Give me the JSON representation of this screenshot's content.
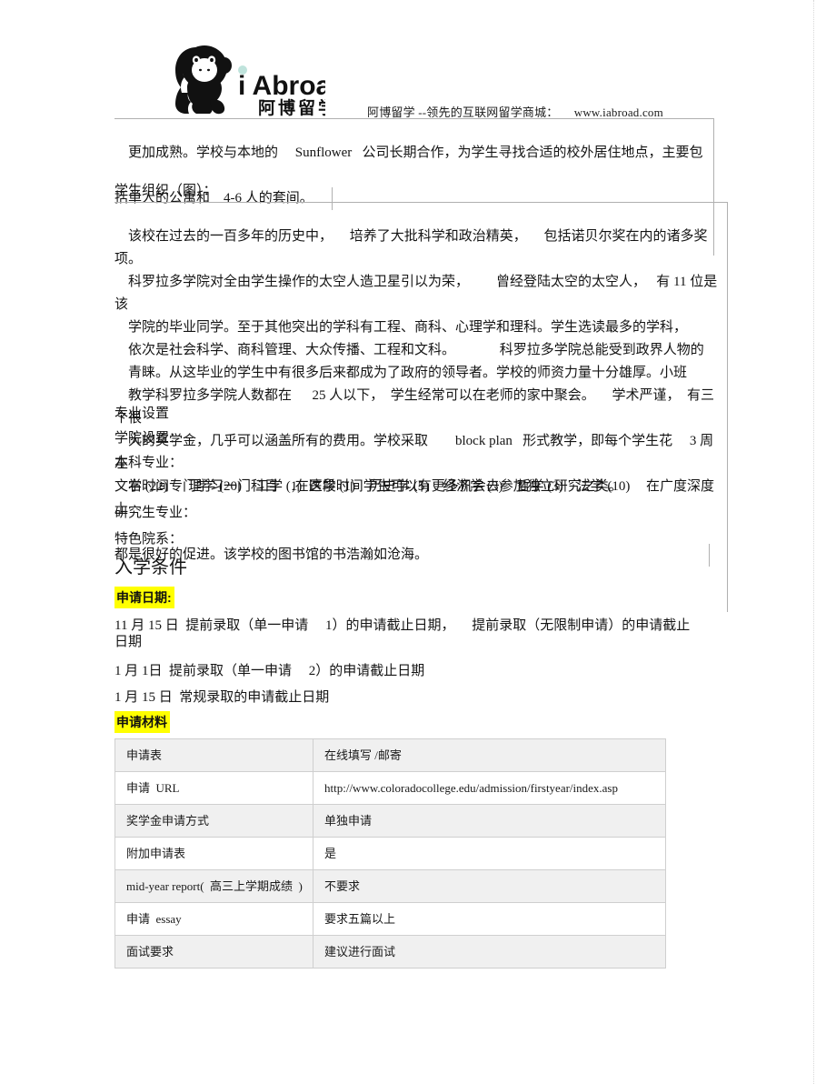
{
  "header": {
    "logo_alt": "iAbroad gorilla logo",
    "logo_text_en": "i Abroad",
    "logo_text_cn": "阿博留学",
    "tagline": "阿博留学 --领先的互联网留学商城：     www.iabroad.com"
  },
  "body": {
    "para_housing_line1": "更加成熟。学校与本地的     Sunflower   公司长期合作，为学生寻找合适的校外居住地点，主要包",
    "para_housing_line2": "括单人的公寓和    4-6 人的套间。",
    "label_student_org": "学生组织（图）：",
    "para_main_lines": [
      "该校在过去的一百多年的历史中，     培养了大批科学和政治精英，     包括诺贝尔奖在内的诸多奖项。",
      "科罗拉多学院对全由学生操作的太空人造卫星引以为荣，        曾经登陆太空的太空人，   有 11 位是该",
      "学院的毕业同学。至于其他突出的学科有工程、商科、心理学和理科。学生选读最多的学科，",
      "依次是社会科学、商科管理、大众传播、工程和文科。             科罗拉多学院总能受到政界人物的",
      "青睐。从这毕业的学生中有很多后来都成为了政府的领导者。学校的师资力量十分雄厚。小班",
      "教学科罗拉多学院人数都在      25 人以下，  学生经常可以在老师的家中聚会。     学术严谨，  有三个很",
      "大的奖学金，几乎可以涵盖所有的费用。学校采取        block plan   形式教学，即每个学生花     3 周左",
      "右时间专门学习一门科目    ,在这段时间学生可以有更多机会去参加独立研究之类。       在广度深度上"
    ],
    "para_main_lastline": "都是很好的促进。该学校的图书馆的书浩瀚如沧海。"
  },
  "programs": {
    "section_title": "专业设置",
    "college_setup_label": "学院设置：",
    "undergrad_label": "本科专业：",
    "majors_line": "文学 (22)      理学 (20)    工学 (1)  医学 (1)    历史学 (5)    经济学 (3)    哲学 (3)    法学 (10)",
    "grad_label": "研究生专业：",
    "featured_label": "特色院系："
  },
  "admission": {
    "heading": "入学条件",
    "dates_badge": "申请日期:",
    "dates": [
      "11 月 15 日  提前录取（单一申请     1）的申请截止日期，     提前录取（无限制申请）的申请截止",
      "日期",
      "1 月 1日  提前录取（单一申请     2）的申请截止日期",
      "1 月 15 日  常规录取的申请截止日期"
    ],
    "materials_badge": "申请材料"
  },
  "materials_table": {
    "rows": [
      {
        "label": "申请表",
        "value": "在线填写 /邮寄"
      },
      {
        "label": "申请  URL",
        "value": "http://www.coloradocollege.edu/admission/firstyear/index.asp"
      },
      {
        "label": "奖学金申请方式",
        "value": "单独申请"
      },
      {
        "label": "附加申请表",
        "value": "是"
      },
      {
        "label": "mid-year report(  高三上学期成绩  )",
        "value": "不要求"
      },
      {
        "label": "申请  essay",
        "value": "要求五篇以上"
      },
      {
        "label": "面试要求",
        "value": "建议进行面试"
      }
    ]
  },
  "colors": {
    "highlight": "#ffff00",
    "table_shade": "#f0f0f0",
    "text": "#141414"
  }
}
